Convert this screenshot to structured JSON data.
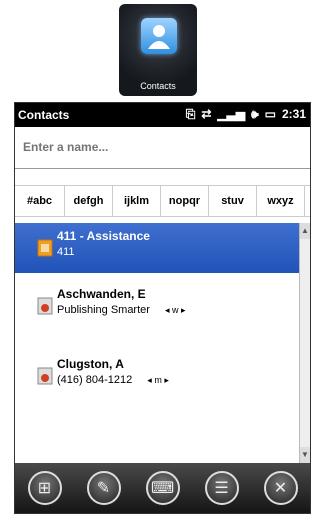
{
  "app_icon": {
    "caption": "Contacts"
  },
  "status_bar": {
    "title": "Contacts",
    "time": "2:31"
  },
  "search": {
    "placeholder": "Enter a name..."
  },
  "alpha_tabs": [
    "#abc",
    "defgh",
    "ijklm",
    "nopqr",
    "stuv",
    "wxyz"
  ],
  "contacts": [
    {
      "name": "411 - Assistance",
      "detail": "411",
      "nav": "",
      "selected": true
    },
    {
      "name": "Aschwanden, E",
      "detail": "Publishing Smarter",
      "nav": "◂ w ▸",
      "selected": false
    },
    {
      "name": "Clugston, A",
      "detail": "(416) 804-1212",
      "nav": "◂ m ▸",
      "selected": false
    }
  ],
  "toolbar": {
    "buttons": [
      "start-icon",
      "new-contact-icon",
      "keyboard-icon",
      "menu-icon",
      "close-icon"
    ]
  },
  "colors": {
    "selection": "#2153b8",
    "status_bar": "#000000"
  }
}
